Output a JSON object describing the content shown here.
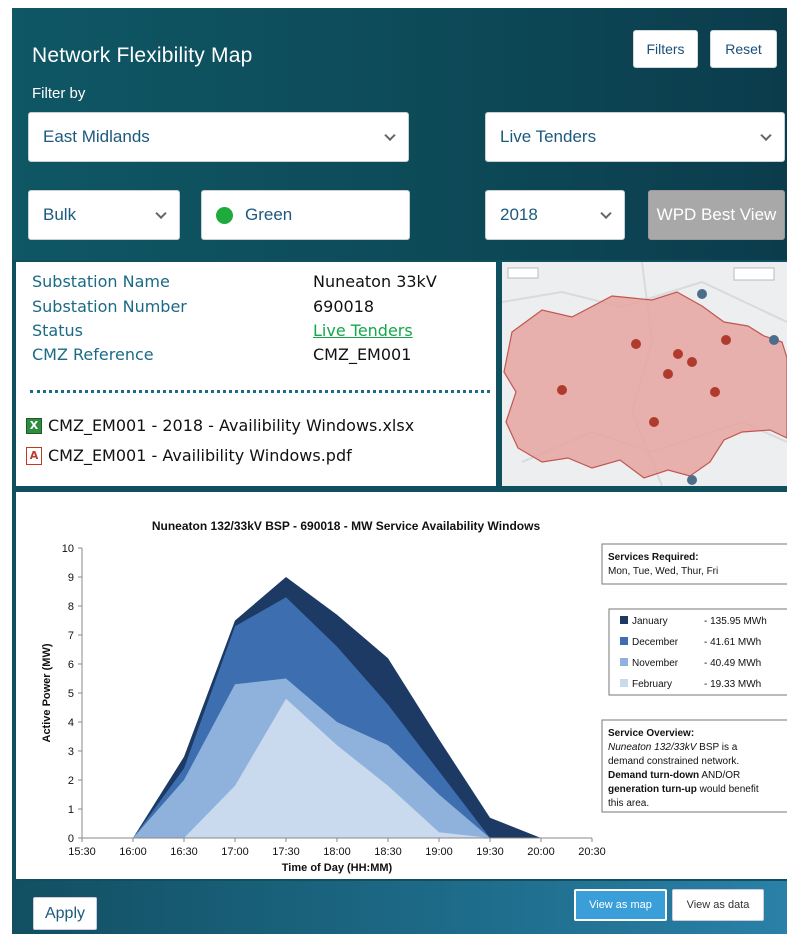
{
  "header": {
    "title": "Network Flexibility Map",
    "filter_by_label": "Filter by",
    "filters_button": "Filters",
    "reset_button": "Reset"
  },
  "filters": {
    "region": "East Midlands",
    "tender_status": "Live Tenders",
    "type": "Bulk",
    "rag_status": "Green",
    "rag_color": "#1faa3c",
    "year": "2018",
    "best_view_button": "WPD Best View"
  },
  "substation": {
    "name_label": "Substation Name",
    "name_value": "Nuneaton 33kV",
    "number_label": "Substation Number",
    "number_value": "690018",
    "status_label": "Status",
    "status_value": "Live Tenders",
    "cmz_label": "CMZ Reference",
    "cmz_value": "CMZ_EM001"
  },
  "files": [
    {
      "name": "CMZ_EM001 - 2018 - Availibility Windows.xlsx",
      "icon": "excel-file-icon"
    },
    {
      "name": "CMZ_EM001 - Availibility Windows.pdf",
      "icon": "pdf-file-icon"
    }
  ],
  "chart_data": {
    "type": "area",
    "title": "Nuneaton 132/33kV BSP - 690018 - MW Service Availability Windows",
    "xlabel": "Time of Day (HH:MM)",
    "ylabel": "Active Power (MW)",
    "ylim": [
      0,
      10
    ],
    "yticks": [
      "0",
      "1",
      "2",
      "3",
      "4",
      "5",
      "6",
      "7",
      "8",
      "9",
      "10"
    ],
    "x": [
      "15:30",
      "16:00",
      "16:30",
      "17:00",
      "17:30",
      "18:00",
      "18:30",
      "19:00",
      "19:30",
      "20:00",
      "20:30"
    ],
    "series": [
      {
        "name": "January",
        "energy": "- 135.95 MWh",
        "color": "#1c3a63",
        "values": [
          0,
          0,
          2.8,
          7.5,
          9.0,
          7.7,
          6.2,
          3.4,
          0.7,
          0,
          0
        ]
      },
      {
        "name": "December",
        "energy": "- 41.61 MWh",
        "color": "#3d6eaf",
        "values": [
          0,
          0,
          2.4,
          7.3,
          8.3,
          6.6,
          4.6,
          2.3,
          0,
          0,
          0
        ]
      },
      {
        "name": "November",
        "energy": "- 40.49 MWh",
        "color": "#8fb2dc",
        "values": [
          0,
          0,
          2.0,
          5.3,
          5.5,
          4.0,
          3.2,
          1.5,
          0,
          0,
          0
        ]
      },
      {
        "name": "February",
        "energy": "- 19.33 MWh",
        "color": "#c9d9ee",
        "values": [
          0,
          0,
          0,
          1.8,
          4.8,
          3.2,
          1.8,
          0.2,
          0,
          0,
          0
        ]
      }
    ],
    "legend_position": "right",
    "services_required_title": "Services Required:",
    "services_required_days": "Mon, Tue, Wed, Thur, Fri",
    "overview_title": "Service Overview:",
    "overview_line1_italic": "Nuneaton 132/33kV",
    "overview_line1_rest": " BSP is a",
    "overview_line2": "demand constrained network.",
    "overview_line3_bold": "Demand turn-down",
    "overview_line3_rest": " AND/OR",
    "overview_line4_bold": "generation turn-up",
    "overview_line4_rest": " would benefit",
    "overview_line5": "this area."
  },
  "footer": {
    "apply_button": "Apply",
    "view_map_button": "View as map",
    "view_data_button": "View as data"
  }
}
